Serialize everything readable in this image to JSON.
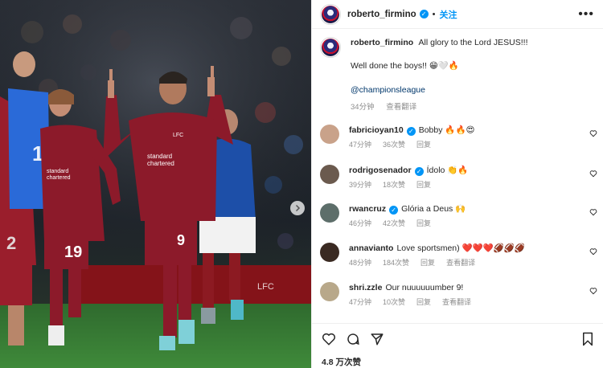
{
  "header": {
    "username": "roberto_firmino",
    "follow_label": "关注",
    "dot": "•"
  },
  "photo": {
    "jersey_number_left": "19",
    "jersey_number_main": "9",
    "sponsor": "standard chartered",
    "board_text": "LFC"
  },
  "caption": {
    "username": "roberto_firmino",
    "line1": "All glory to the Lord JESUS!!!",
    "line2": "Well done the boys!! 😁🤍🔥",
    "tag": "@championsleague",
    "time": "34分钟",
    "translate": "查看翻译"
  },
  "comments": [
    {
      "username": "fabricioyan10",
      "verified": true,
      "text": "Bobby 🔥🔥😍",
      "time": "47分钟",
      "likes": "36次赞",
      "reply": "回复",
      "translate": "",
      "avatar_color": "#c9a28a"
    },
    {
      "username": "rodrigosenador",
      "verified": true,
      "text": "Ídolo 👏🔥",
      "time": "39分钟",
      "likes": "18次赞",
      "reply": "回复",
      "translate": "",
      "avatar_color": "#6b5a4e"
    },
    {
      "username": "rwancruz",
      "verified": true,
      "text": "Glória a Deus 🙌",
      "time": "46分钟",
      "likes": "42次赞",
      "reply": "回复",
      "translate": "",
      "avatar_color": "#5d6e6a"
    },
    {
      "username": "annavianto",
      "verified": false,
      "text": "Love sportsmen) ❤️❤️❤️🏈🏈🏈",
      "time": "48分钟",
      "likes": "184次赞",
      "reply": "回复",
      "translate": "查看翻译",
      "avatar_color": "#3a2a22"
    },
    {
      "username": "shri.zzle",
      "verified": false,
      "text": "Our nuuuuuumber 9!",
      "time": "47分钟",
      "likes": "10次赞",
      "reply": "回复",
      "translate": "查看翻译",
      "avatar_color": "#b8a88a"
    }
  ],
  "footer": {
    "likes": "4.8 万次赞"
  },
  "icons": [
    "more-icon",
    "heart-icon",
    "comment-icon",
    "share-icon",
    "bookmark-icon",
    "chevron-right-icon",
    "verified-icon"
  ],
  "colors": {
    "accent": "#0095f6",
    "liverpool_red": "#8c1a2a",
    "rangers_blue": "#1d4fa8",
    "muted": "#8e8e8e"
  }
}
